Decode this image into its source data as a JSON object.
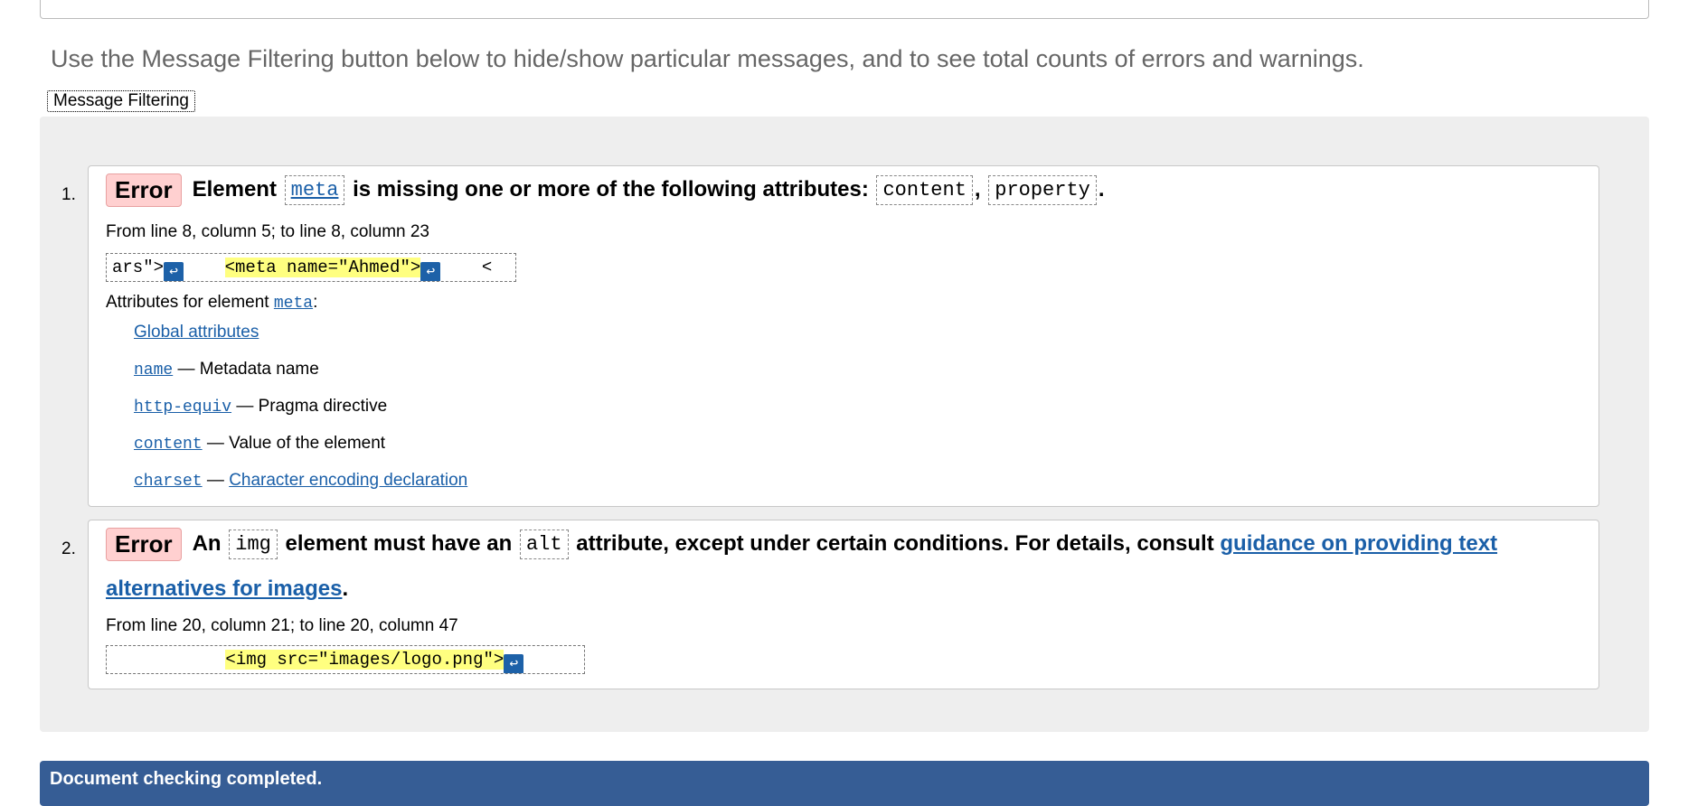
{
  "intro_text": "Use the Message Filtering button below to hide/show particular messages, and to see total counts of errors and warnings.",
  "filter_button": "Message Filtering",
  "messages": [
    {
      "number": "1.",
      "badge": "Error",
      "parts": {
        "a": "Element",
        "element": "meta",
        "b": "is missing one or more of the following attributes:",
        "attr1": "content",
        "sep": ",",
        "attr2": "property",
        "end": "."
      },
      "location": "From line 8, column 5; to line 8, column 23",
      "extract": {
        "pre": "ars\">",
        "gap": "    ",
        "highlight": "<meta name=\"Ahmed\">",
        "post": "    <"
      },
      "attrs_heading": "Attributes for element",
      "attrs_element": "meta",
      "attrs_colon": ":",
      "attributes": [
        {
          "name": "Global attributes",
          "desc": ""
        },
        {
          "name": "name",
          "desc": "— Metadata name"
        },
        {
          "name": "http-equiv",
          "desc": "— Pragma directive"
        },
        {
          "name": "content",
          "desc": "— Value of the element"
        },
        {
          "name": "charset",
          "dash": "—",
          "desc_link": "Character encoding declaration"
        }
      ]
    },
    {
      "number": "2.",
      "badge": "Error",
      "parts": {
        "a": "An",
        "element": "img",
        "b": "element must have an",
        "attr": "alt",
        "c": "attribute, except under certain conditions. For details, consult",
        "link1": "guidance on providing text",
        "link2": "alternatives for images",
        "end": "."
      },
      "location": "From line 20, column 21; to line 20, column 47",
      "extract": {
        "pre": "           ",
        "highlight": "<img src=\"images/logo.png\">"
      }
    }
  ],
  "status": "Document checking completed.",
  "colors": {
    "error_badge_bg": "#ffd0d0",
    "status_bar_bg": "#365d95",
    "link": "#1a5fa8",
    "highlight": "#ffff80"
  },
  "icons": {
    "line_break": "line-break-icon"
  }
}
